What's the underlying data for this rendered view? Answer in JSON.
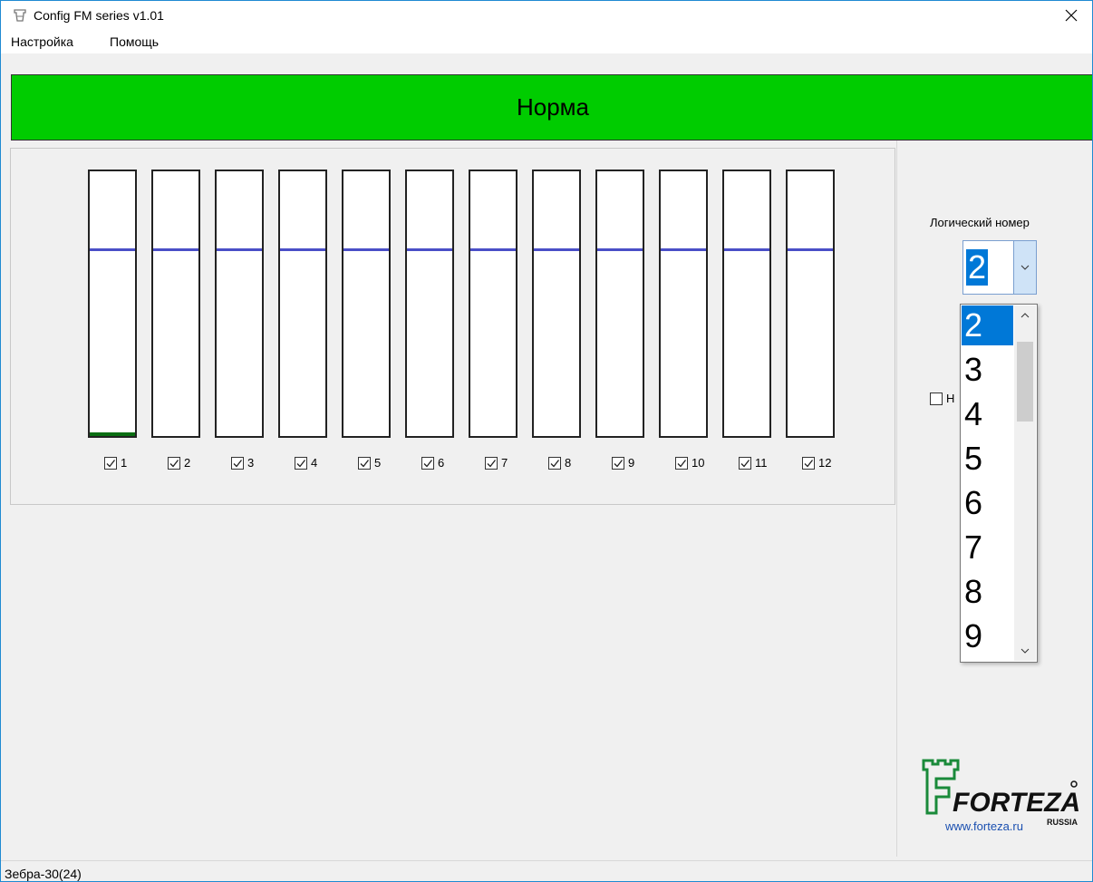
{
  "window": {
    "title": "Config FM series v1.01",
    "close_glyph": "✕",
    "icon": "fortress-tower-icon"
  },
  "menu": {
    "items": [
      {
        "label": "Настройка"
      },
      {
        "label": "Помощь"
      }
    ]
  },
  "status_banner": {
    "text": "Норма",
    "color": "#00cc00"
  },
  "channels": {
    "threshold_fraction": 0.71,
    "items": [
      {
        "label": "1",
        "checked": true,
        "level_fraction": 0.015
      },
      {
        "label": "2",
        "checked": true,
        "level_fraction": 0
      },
      {
        "label": "3",
        "checked": true,
        "level_fraction": 0
      },
      {
        "label": "4",
        "checked": true,
        "level_fraction": 0
      },
      {
        "label": "5",
        "checked": true,
        "level_fraction": 0
      },
      {
        "label": "6",
        "checked": true,
        "level_fraction": 0
      },
      {
        "label": "7",
        "checked": true,
        "level_fraction": 0
      },
      {
        "label": "8",
        "checked": true,
        "level_fraction": 0
      },
      {
        "label": "9",
        "checked": true,
        "level_fraction": 0
      },
      {
        "label": "10",
        "checked": true,
        "level_fraction": 0
      },
      {
        "label": "11",
        "checked": true,
        "level_fraction": 0
      },
      {
        "label": "12",
        "checked": true,
        "level_fraction": 0
      }
    ]
  },
  "logical_number": {
    "label": "Логический номер",
    "value": "2",
    "options": [
      "2",
      "3",
      "4",
      "5",
      "6",
      "7",
      "8",
      "9"
    ],
    "selected_index": 0
  },
  "partial_checkbox": {
    "label": "Н",
    "checked": false
  },
  "logo": {
    "text": "FORTEZA",
    "sub": "RUSSIA",
    "url": "www.forteza.ru"
  },
  "statusbar": {
    "text": "Зебра-30(24)"
  }
}
